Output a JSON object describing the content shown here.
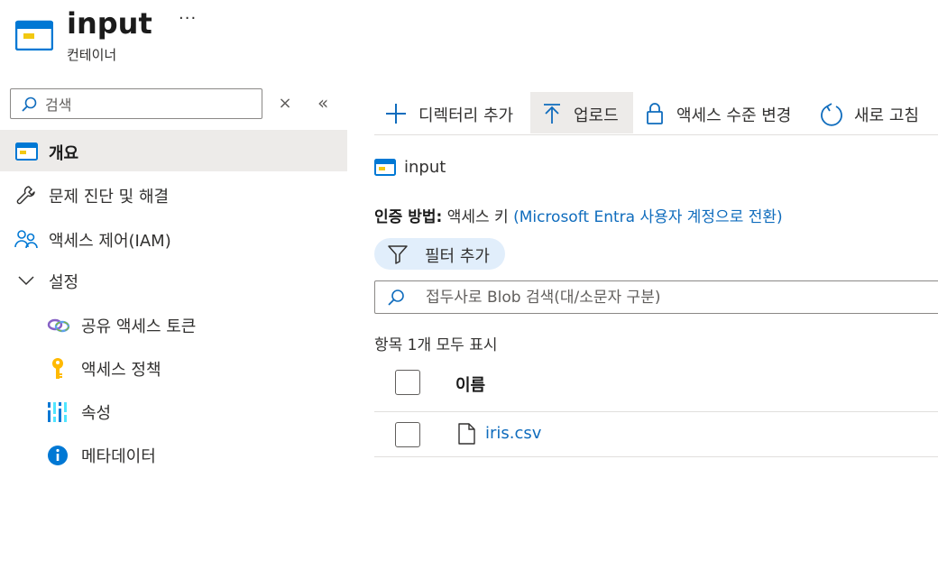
{
  "header": {
    "title": "input",
    "subtitle": "컨테이너",
    "more": "···"
  },
  "search": {
    "placeholder": "검색",
    "clear": "×",
    "collapse": "«"
  },
  "sidebar": {
    "items": [
      {
        "label": "개요",
        "icon": "container-icon",
        "selected": true
      },
      {
        "label": "문제 진단 및 해결",
        "icon": "wrench-icon"
      },
      {
        "label": "액세스 제어(IAM)",
        "icon": "people-icon"
      },
      {
        "label": "설정",
        "icon": "chevron-down-icon"
      },
      {
        "label": "공유 액세스 토큰",
        "icon": "link-icon"
      },
      {
        "label": "액세스 정책",
        "icon": "key-icon"
      },
      {
        "label": "속성",
        "icon": "properties-icon"
      },
      {
        "label": "메타데이터",
        "icon": "info-icon"
      }
    ]
  },
  "toolbar": {
    "add_directory": "디렉터리 추가",
    "upload": "업로드",
    "change_access": "액세스 수준 변경",
    "refresh": "새로 고침"
  },
  "main": {
    "breadcrumb": "input",
    "auth_label": "인증 방법:",
    "auth_value": "액세스 키",
    "auth_link": "(Microsoft Entra 사용자 계정으로 전환)",
    "filter_label": "필터 추가",
    "blob_search_placeholder": "접두사로 Blob 검색(대/소문자 구분)",
    "item_count": "항목 1개 모두 표시",
    "column_name": "이름",
    "files": [
      {
        "name": "iris.csv"
      }
    ]
  },
  "colors": {
    "accent": "#0f6cbd",
    "selected_bg": "#edebe9",
    "pill_bg": "#e1eefb"
  }
}
